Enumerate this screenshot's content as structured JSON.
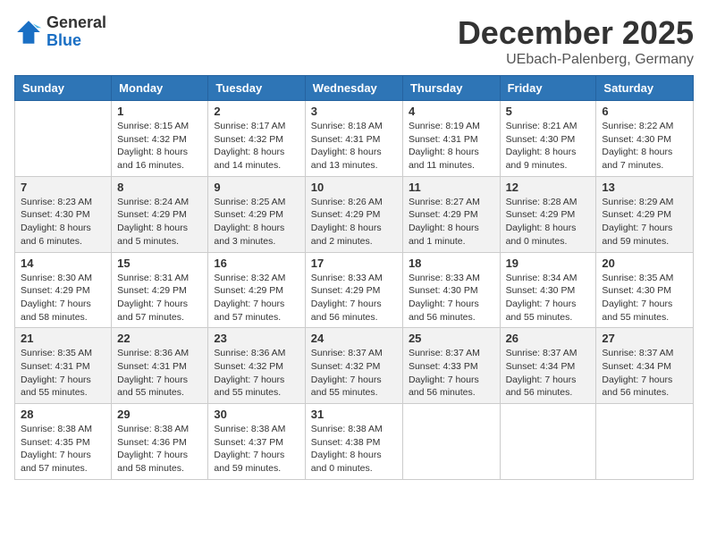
{
  "logo": {
    "general": "General",
    "blue": "Blue"
  },
  "title": "December 2025",
  "location": "UEbach-Palenberg, Germany",
  "weekdays": [
    "Sunday",
    "Monday",
    "Tuesday",
    "Wednesday",
    "Thursday",
    "Friday",
    "Saturday"
  ],
  "weeks": [
    [
      {
        "day": "",
        "info": ""
      },
      {
        "day": "1",
        "info": "Sunrise: 8:15 AM\nSunset: 4:32 PM\nDaylight: 8 hours\nand 16 minutes."
      },
      {
        "day": "2",
        "info": "Sunrise: 8:17 AM\nSunset: 4:32 PM\nDaylight: 8 hours\nand 14 minutes."
      },
      {
        "day": "3",
        "info": "Sunrise: 8:18 AM\nSunset: 4:31 PM\nDaylight: 8 hours\nand 13 minutes."
      },
      {
        "day": "4",
        "info": "Sunrise: 8:19 AM\nSunset: 4:31 PM\nDaylight: 8 hours\nand 11 minutes."
      },
      {
        "day": "5",
        "info": "Sunrise: 8:21 AM\nSunset: 4:30 PM\nDaylight: 8 hours\nand 9 minutes."
      },
      {
        "day": "6",
        "info": "Sunrise: 8:22 AM\nSunset: 4:30 PM\nDaylight: 8 hours\nand 7 minutes."
      }
    ],
    [
      {
        "day": "7",
        "info": "Sunrise: 8:23 AM\nSunset: 4:30 PM\nDaylight: 8 hours\nand 6 minutes."
      },
      {
        "day": "8",
        "info": "Sunrise: 8:24 AM\nSunset: 4:29 PM\nDaylight: 8 hours\nand 5 minutes."
      },
      {
        "day": "9",
        "info": "Sunrise: 8:25 AM\nSunset: 4:29 PM\nDaylight: 8 hours\nand 3 minutes."
      },
      {
        "day": "10",
        "info": "Sunrise: 8:26 AM\nSunset: 4:29 PM\nDaylight: 8 hours\nand 2 minutes."
      },
      {
        "day": "11",
        "info": "Sunrise: 8:27 AM\nSunset: 4:29 PM\nDaylight: 8 hours\nand 1 minute."
      },
      {
        "day": "12",
        "info": "Sunrise: 8:28 AM\nSunset: 4:29 PM\nDaylight: 8 hours\nand 0 minutes."
      },
      {
        "day": "13",
        "info": "Sunrise: 8:29 AM\nSunset: 4:29 PM\nDaylight: 7 hours\nand 59 minutes."
      }
    ],
    [
      {
        "day": "14",
        "info": "Sunrise: 8:30 AM\nSunset: 4:29 PM\nDaylight: 7 hours\nand 58 minutes."
      },
      {
        "day": "15",
        "info": "Sunrise: 8:31 AM\nSunset: 4:29 PM\nDaylight: 7 hours\nand 57 minutes."
      },
      {
        "day": "16",
        "info": "Sunrise: 8:32 AM\nSunset: 4:29 PM\nDaylight: 7 hours\nand 57 minutes."
      },
      {
        "day": "17",
        "info": "Sunrise: 8:33 AM\nSunset: 4:29 PM\nDaylight: 7 hours\nand 56 minutes."
      },
      {
        "day": "18",
        "info": "Sunrise: 8:33 AM\nSunset: 4:30 PM\nDaylight: 7 hours\nand 56 minutes."
      },
      {
        "day": "19",
        "info": "Sunrise: 8:34 AM\nSunset: 4:30 PM\nDaylight: 7 hours\nand 55 minutes."
      },
      {
        "day": "20",
        "info": "Sunrise: 8:35 AM\nSunset: 4:30 PM\nDaylight: 7 hours\nand 55 minutes."
      }
    ],
    [
      {
        "day": "21",
        "info": "Sunrise: 8:35 AM\nSunset: 4:31 PM\nDaylight: 7 hours\nand 55 minutes."
      },
      {
        "day": "22",
        "info": "Sunrise: 8:36 AM\nSunset: 4:31 PM\nDaylight: 7 hours\nand 55 minutes."
      },
      {
        "day": "23",
        "info": "Sunrise: 8:36 AM\nSunset: 4:32 PM\nDaylight: 7 hours\nand 55 minutes."
      },
      {
        "day": "24",
        "info": "Sunrise: 8:37 AM\nSunset: 4:32 PM\nDaylight: 7 hours\nand 55 minutes."
      },
      {
        "day": "25",
        "info": "Sunrise: 8:37 AM\nSunset: 4:33 PM\nDaylight: 7 hours\nand 56 minutes."
      },
      {
        "day": "26",
        "info": "Sunrise: 8:37 AM\nSunset: 4:34 PM\nDaylight: 7 hours\nand 56 minutes."
      },
      {
        "day": "27",
        "info": "Sunrise: 8:37 AM\nSunset: 4:34 PM\nDaylight: 7 hours\nand 56 minutes."
      }
    ],
    [
      {
        "day": "28",
        "info": "Sunrise: 8:38 AM\nSunset: 4:35 PM\nDaylight: 7 hours\nand 57 minutes."
      },
      {
        "day": "29",
        "info": "Sunrise: 8:38 AM\nSunset: 4:36 PM\nDaylight: 7 hours\nand 58 minutes."
      },
      {
        "day": "30",
        "info": "Sunrise: 8:38 AM\nSunset: 4:37 PM\nDaylight: 7 hours\nand 59 minutes."
      },
      {
        "day": "31",
        "info": "Sunrise: 8:38 AM\nSunset: 4:38 PM\nDaylight: 8 hours\nand 0 minutes."
      },
      {
        "day": "",
        "info": ""
      },
      {
        "day": "",
        "info": ""
      },
      {
        "day": "",
        "info": ""
      }
    ]
  ]
}
